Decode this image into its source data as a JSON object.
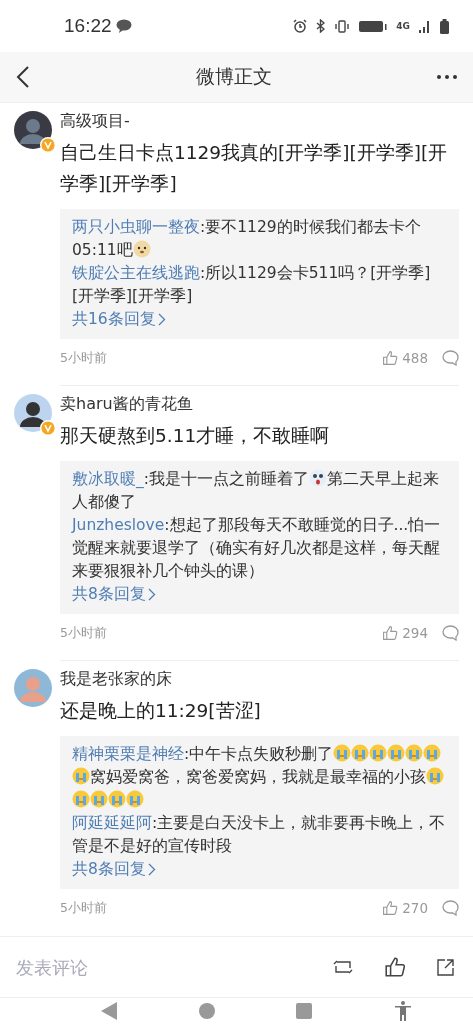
{
  "status_bar": {
    "time": "16:22",
    "network": "4G"
  },
  "header": {
    "title": "微博正文"
  },
  "comments": [
    {
      "author": "高级项目-",
      "verified": true,
      "text": "自己生日卡点1129我真的[开学季][开学季][开学季][开学季]",
      "replies": [
        {
          "author": "两只小虫聊一整夜",
          "parts": [
            {
              "kind": "text",
              "text": ":要不1129的时候我们都去卡个05:11吧"
            },
            {
              "kind": "doge"
            }
          ]
        },
        {
          "author": "铁腚公主在线逃跑",
          "parts": [
            {
              "kind": "text",
              "text": ":所以1129会卡511吗？[开学季][开学季][开学季]"
            }
          ]
        }
      ],
      "more": "共16条回复",
      "time": "5小时前",
      "likes": "488"
    },
    {
      "author": "卖haru酱的青花鱼",
      "verified": true,
      "text": "那天硬熬到5.11才睡，不敢睡啊",
      "replies": [
        {
          "author": "敷冰取暖_",
          "parts": [
            {
              "kind": "text",
              "text": ":我是十一点之前睡着了"
            },
            {
              "kind": "shocked"
            },
            {
              "kind": "text",
              "text": "第二天早上起来人都傻了"
            }
          ]
        },
        {
          "author": "Junzheslove",
          "parts": [
            {
              "kind": "text",
              "text": ":想起了那段每天不敢睡觉的日子...怕一觉醒来就要退学了（确实有好几次都是这样，每天醒来要狠狠补几个钟头的课）"
            }
          ]
        }
      ],
      "more": "共8条回复",
      "time": "5小时前",
      "likes": "294"
    },
    {
      "author": "我是老张家的床",
      "verified": false,
      "text": "还是晚上的11:29[苦涩]",
      "replies": [
        {
          "author": "精神栗栗是神经",
          "parts": [
            {
              "kind": "text",
              "text": ":中午卡点失败秒删了"
            },
            {
              "kind": "crying"
            },
            {
              "kind": "crying"
            },
            {
              "kind": "crying"
            },
            {
              "kind": "crying"
            },
            {
              "kind": "crying"
            },
            {
              "kind": "crying"
            },
            {
              "kind": "crying"
            },
            {
              "kind": "text",
              "text": "窝妈爱窝爸，窝爸爱窝妈，我就是最幸福的小孩"
            },
            {
              "kind": "crying"
            },
            {
              "kind": "crying"
            },
            {
              "kind": "crying"
            },
            {
              "kind": "crying"
            },
            {
              "kind": "crying"
            }
          ]
        },
        {
          "author": "阿延延延阿",
          "parts": [
            {
              "kind": "text",
              "text": ":主要是白天没卡上，就非要再卡晚上，不管是不是好的宣传时段"
            }
          ]
        }
      ],
      "more": "共8条回复",
      "time": "5小时前",
      "likes": "270"
    }
  ],
  "comment_bar": {
    "placeholder": "发表评论"
  }
}
